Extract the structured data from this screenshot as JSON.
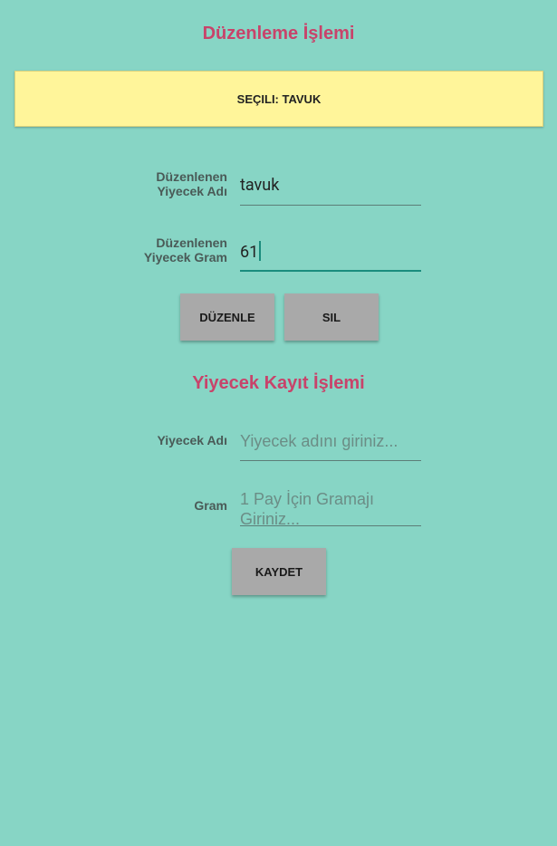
{
  "edit_section": {
    "title": "Düzenleme İşlemi",
    "selected_banner": "SEÇILI: TAVUK",
    "name_label_line1": "Düzenlenen",
    "name_label_line2": "Yiyecek Adı",
    "name_value": "tavuk",
    "gram_label_line1": "Düzenlenen",
    "gram_label_line2": "Yiyecek Gram",
    "gram_value": "61",
    "edit_button": "DÜZENLE",
    "delete_button": "SIL"
  },
  "save_section": {
    "title": "Yiyecek Kayıt İşlemi",
    "name_label": "Yiyecek Adı",
    "name_placeholder": "Yiyecek adını giriniz...",
    "gram_label": "Gram",
    "gram_placeholder": "1 Pay İçin Gramajı Giriniz...",
    "save_button": "KAYDET"
  },
  "colors": {
    "background": "#87d5c5",
    "title": "#c8436a",
    "banner": "#fff59a",
    "button": "#a9a9a9",
    "accent": "#1a8c7d"
  }
}
